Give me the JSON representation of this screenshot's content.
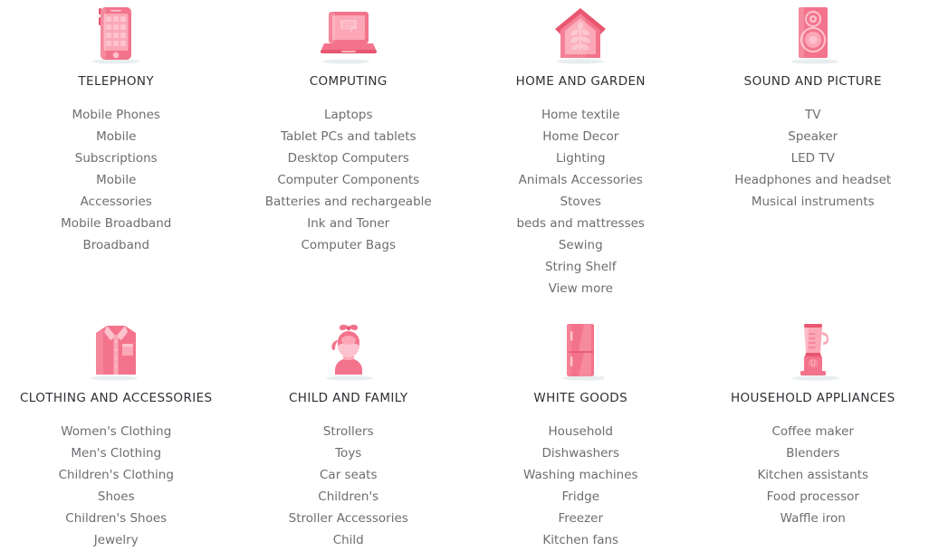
{
  "theme": {
    "icon_primary": "#f4738c",
    "icon_light": "#fba7b6",
    "icon_lighter": "#fcc3ce",
    "icon_dark": "#e8566f",
    "shadow": "#e8eef0",
    "title_color": "#2f2f35",
    "link_color": "#6d6d72",
    "background": "#ffffff"
  },
  "categories": [
    {
      "id": "telephony",
      "title": "TELEPHONY",
      "icon": "smartphone-icon",
      "items": [
        "Mobile Phones",
        "Mobile",
        "Subscriptions",
        "Mobile",
        "Accessories",
        "Mobile Broadband",
        "Broadband"
      ]
    },
    {
      "id": "computing",
      "title": "COMPUTING",
      "icon": "laptop-icon",
      "items": [
        "Laptops",
        "Tablet PCs and tablets",
        "Desktop Computers",
        "Computer Components",
        "Batteries and rechargeable",
        "Ink and Toner",
        "Computer Bags"
      ]
    },
    {
      "id": "home-and-garden",
      "title": "HOME AND GARDEN",
      "icon": "house-plant-icon",
      "items": [
        "Home textile",
        "Home Decor",
        "Lighting",
        "Animals Accessories",
        "Stoves",
        "beds and mattresses",
        "Sewing",
        "String Shelf",
        "View more"
      ]
    },
    {
      "id": "sound-and-picture",
      "title": "SOUND AND PICTURE",
      "icon": "speaker-icon",
      "items": [
        "TV",
        "Speaker",
        "LED TV",
        "Headphones and headset",
        "Musical instruments"
      ]
    },
    {
      "id": "clothing-and-accessories",
      "title": "CLOTHING AND ACCESSORIES",
      "icon": "shirt-icon",
      "items": [
        "Women's Clothing",
        "Men's Clothing",
        "Children's Clothing",
        "Shoes",
        "Children's Shoes",
        "Jewelry"
      ]
    },
    {
      "id": "child-and-family",
      "title": "CHILD AND FAMILY",
      "icon": "child-propeller-cap-icon",
      "items": [
        "Strollers",
        "Toys",
        "Car seats",
        "Children's",
        "Stroller Accessories",
        "Child"
      ]
    },
    {
      "id": "white-goods",
      "title": "WHITE GOODS",
      "icon": "refrigerator-icon",
      "items": [
        "Household",
        "Dishwashers",
        "Washing machines",
        "Fridge",
        "Freezer",
        "Kitchen fans"
      ]
    },
    {
      "id": "household-appliances",
      "title": "HOUSEHOLD APPLIANCES",
      "icon": "blender-icon",
      "items": [
        "Coffee maker",
        "Blenders",
        "Kitchen assistants",
        "Food processor",
        "Waffle iron"
      ]
    }
  ]
}
